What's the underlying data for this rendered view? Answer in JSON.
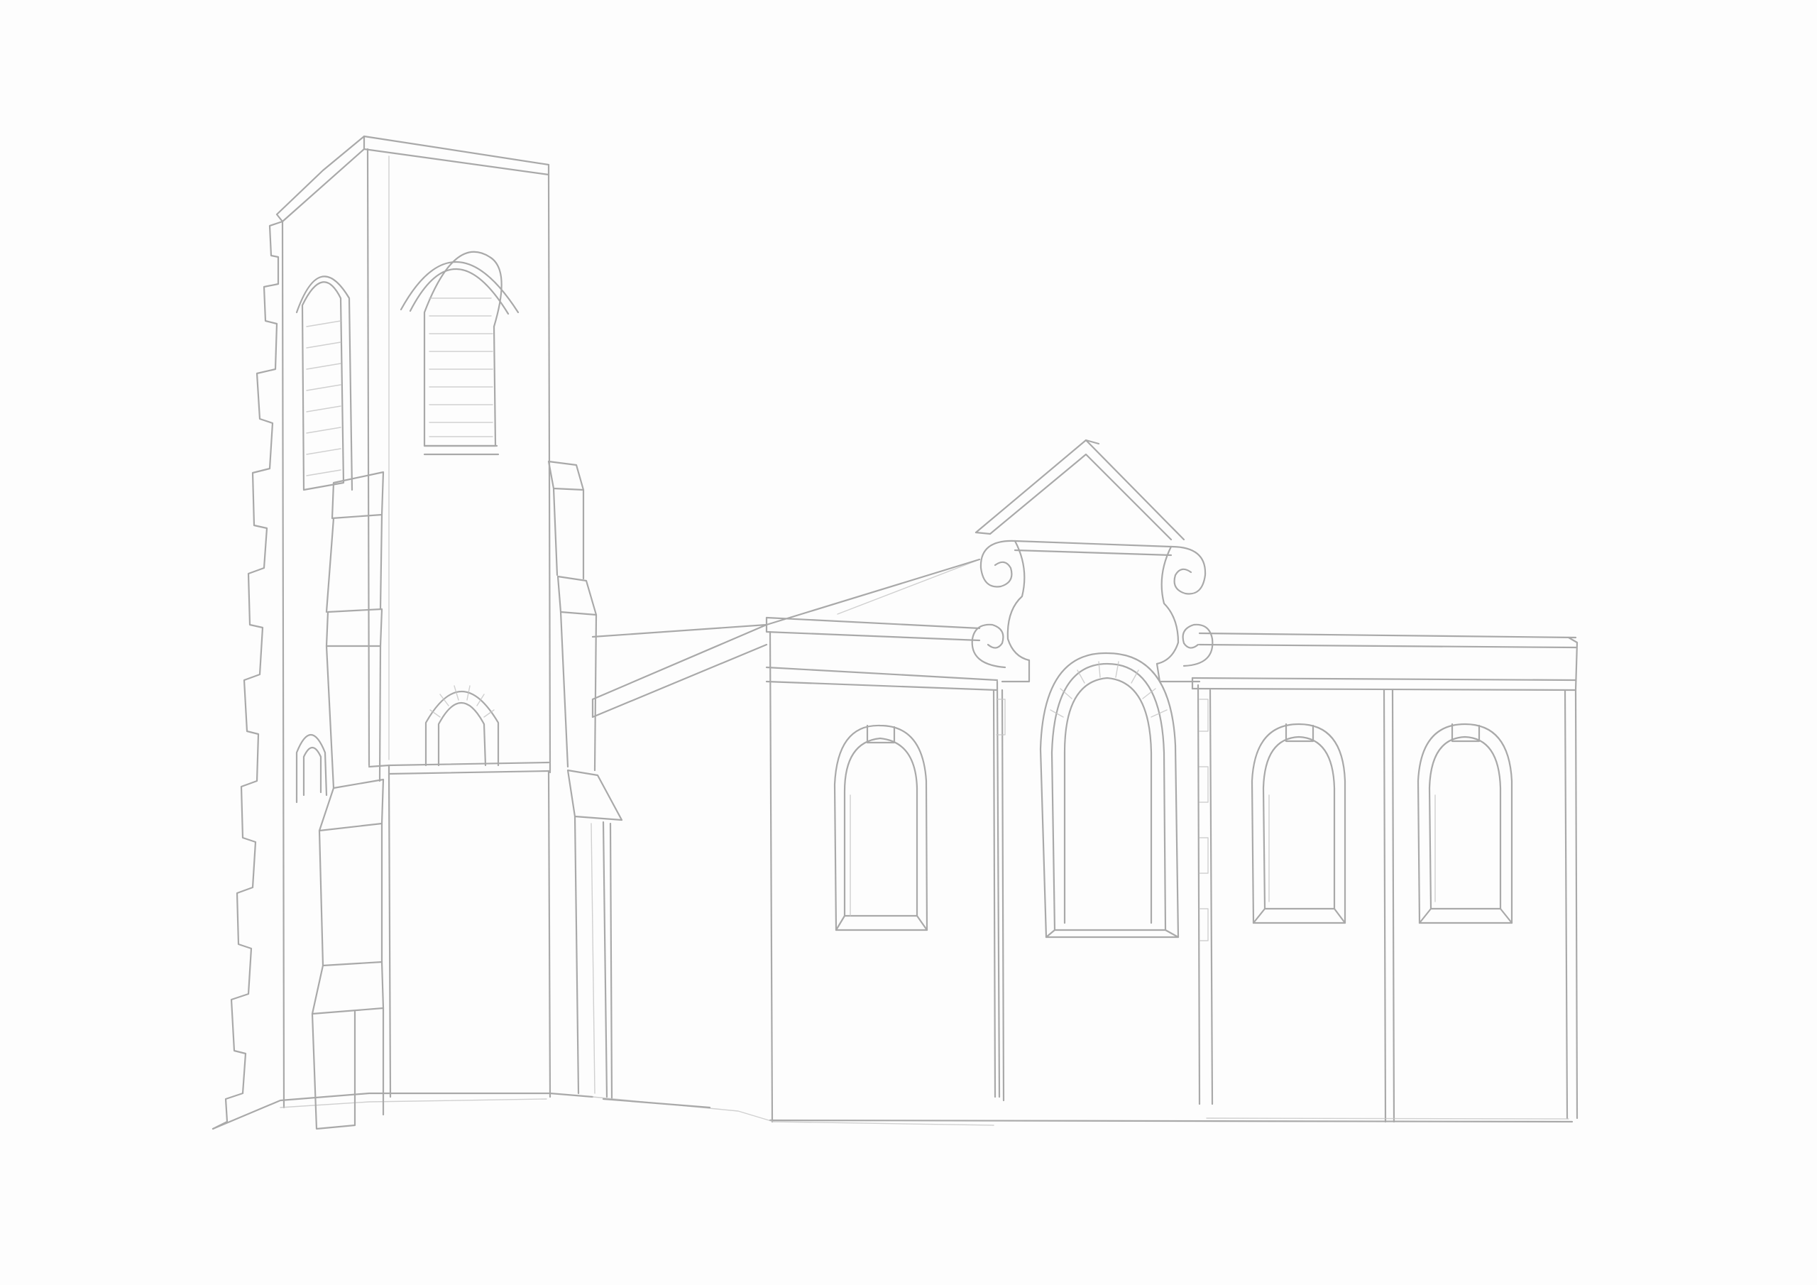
{
  "sketch": {
    "subject": "church-building",
    "medium": "pencil",
    "colors": {
      "paper": "#fdfdfd",
      "graphite": "#a9a9a9",
      "graphite_light": "#c4c4c4"
    }
  }
}
